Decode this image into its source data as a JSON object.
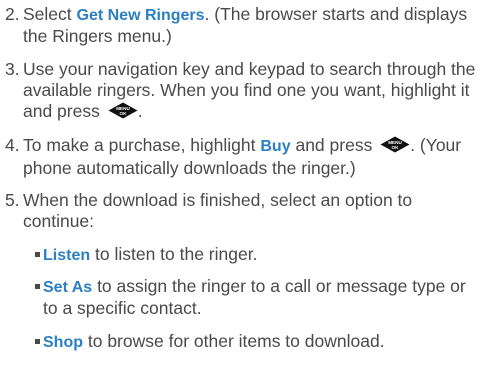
{
  "steps": [
    {
      "number": "2.",
      "pre": "Select ",
      "highlight": "Get New Ringers",
      "post": ". (The browser starts and displays the Ringers menu.)"
    },
    {
      "number": "3.",
      "pre": "Use your navigation key and keypad to search through the available ringers. When you find one you want, highlight it and press",
      "post": "."
    },
    {
      "number": "4.",
      "pre": "To make a purchase, highlight ",
      "highlight": "Buy",
      "mid": " and press",
      "post": ". (Your phone automatically downloads the ringer.)"
    },
    {
      "number": "5.",
      "pre": "When the download is finished, select an option to continue:"
    }
  ],
  "options": [
    {
      "label": "Listen",
      "text": " to listen to the ringer."
    },
    {
      "label": "Set As",
      "text": " to assign the ringer to a call or message type or to a specific contact."
    },
    {
      "label": "Shop",
      "text": " to browse for other items to download."
    }
  ],
  "menu_button": {
    "top_label": "MENU",
    "bottom_label": "OK",
    "icon": "menu-ok-key-icon"
  },
  "colors": {
    "text": "#4a4a4a",
    "highlight": "#2b7fc4"
  }
}
